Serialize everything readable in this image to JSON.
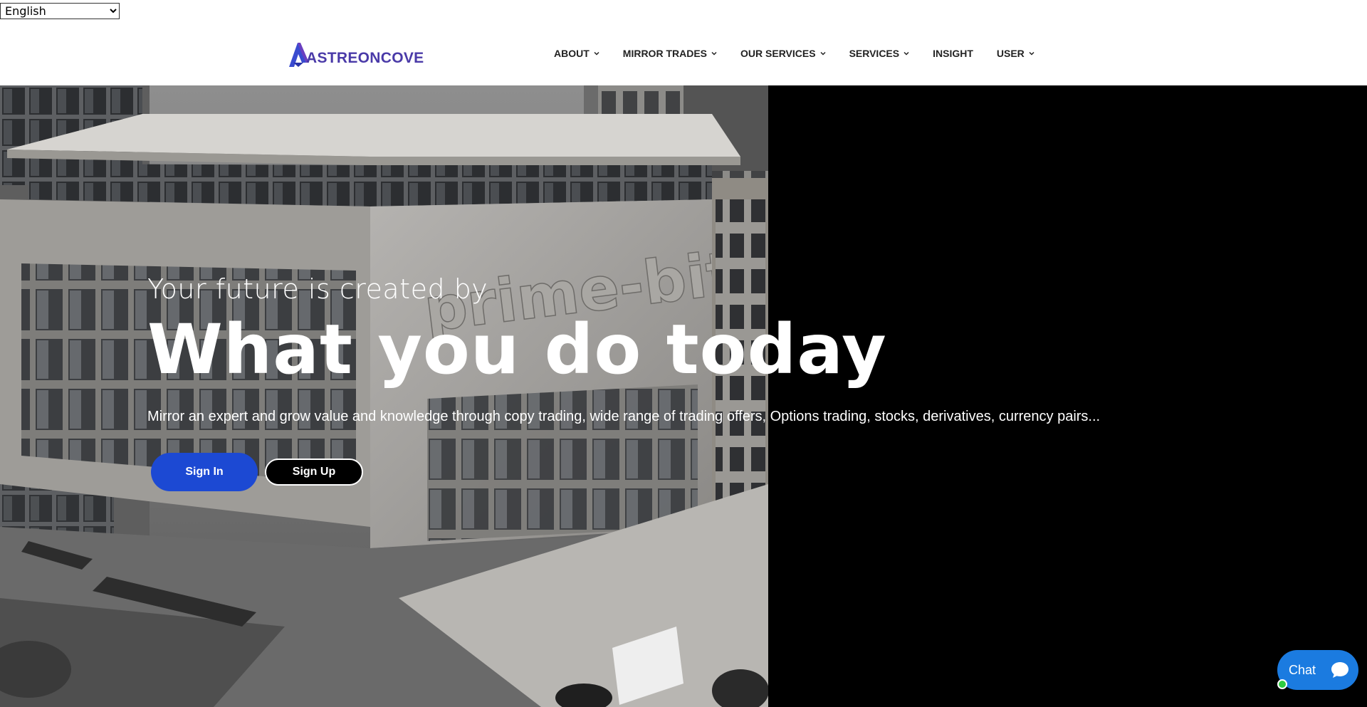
{
  "language_select": {
    "selected": "English"
  },
  "brand": {
    "logo_text": "ASTREONCOVE",
    "color": "#4a3aa8",
    "accent": "#1c49d3"
  },
  "nav": {
    "items": [
      {
        "label": "ABOUT",
        "has_dropdown": true
      },
      {
        "label": "MIRROR TRADES",
        "has_dropdown": true
      },
      {
        "label": "OUR SERVICES",
        "has_dropdown": true
      },
      {
        "label": "SERVICES",
        "has_dropdown": true
      },
      {
        "label": "INSIGHT",
        "has_dropdown": false
      },
      {
        "label": "USER",
        "has_dropdown": true
      }
    ]
  },
  "hero": {
    "kicker": "Your future is created by",
    "headline": "What you do today",
    "subtext": "Mirror an expert and grow value and knowledge through copy trading, wide range of trading offers, Options trading, stocks, derivatives, currency pairs...",
    "building_sign": "prime-bit",
    "buttons": {
      "sign_in": "Sign In",
      "sign_up": "Sign Up"
    }
  },
  "chat": {
    "label": "Chat",
    "status_color": "#2ecc40"
  },
  "colors": {
    "primary_button": "#1c49d3",
    "chat_button": "#1b7be0",
    "hero_bg": "#000000"
  }
}
